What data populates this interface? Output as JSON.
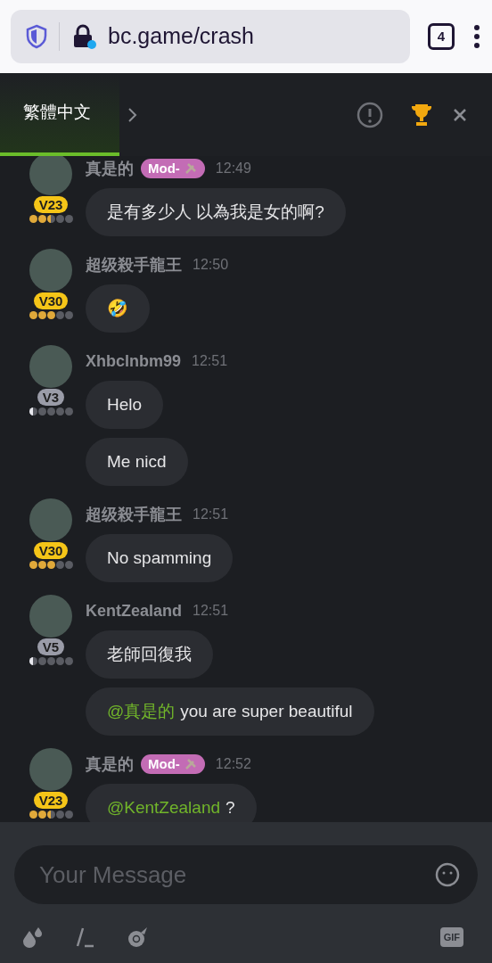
{
  "browser": {
    "url": "bc.game/crash",
    "tab_count": "4"
  },
  "header": {
    "language": "繁體中文",
    "selected": true
  },
  "messages": [
    {
      "name": "真是的",
      "mod_badge": "Mod-",
      "time": "12:49",
      "vip": "V23",
      "kind": "gold",
      "stars": 2.5,
      "bubbles": [
        {
          "text": "是有多少人 以為我是女的啊?"
        }
      ]
    },
    {
      "name": "超级殺手龍王",
      "time": "12:50",
      "vip": "V30",
      "kind": "gold",
      "stars": 3,
      "bubbles": [
        {
          "text": "🤣"
        }
      ]
    },
    {
      "name": "Xhbclnbm99",
      "time": "12:51",
      "vip": "V3",
      "kind": "silver",
      "stars": 0.5,
      "bubbles": [
        {
          "text": "Helo"
        },
        {
          "text": "Me nicd"
        }
      ]
    },
    {
      "name": "超级殺手龍王",
      "time": "12:51",
      "vip": "V30",
      "kind": "gold",
      "stars": 3,
      "bubbles": [
        {
          "text": "No spamming"
        }
      ]
    },
    {
      "name": "KentZealand",
      "time": "12:51",
      "vip": "V5",
      "kind": "silver",
      "stars": 0.5,
      "bubbles": [
        {
          "text": "老師回復我"
        },
        {
          "mention": "@真是的",
          "text": "you are super beautiful"
        }
      ]
    },
    {
      "name": "真是的",
      "mod_badge": "Mod-",
      "time": "12:52",
      "vip": "V23",
      "kind": "gold",
      "stars": 2.5,
      "bubbles": [
        {
          "mention": "@KentZealand",
          "text": "?"
        }
      ]
    }
  ],
  "composer": {
    "placeholder": "Your Message",
    "gif_label": "GIF"
  }
}
